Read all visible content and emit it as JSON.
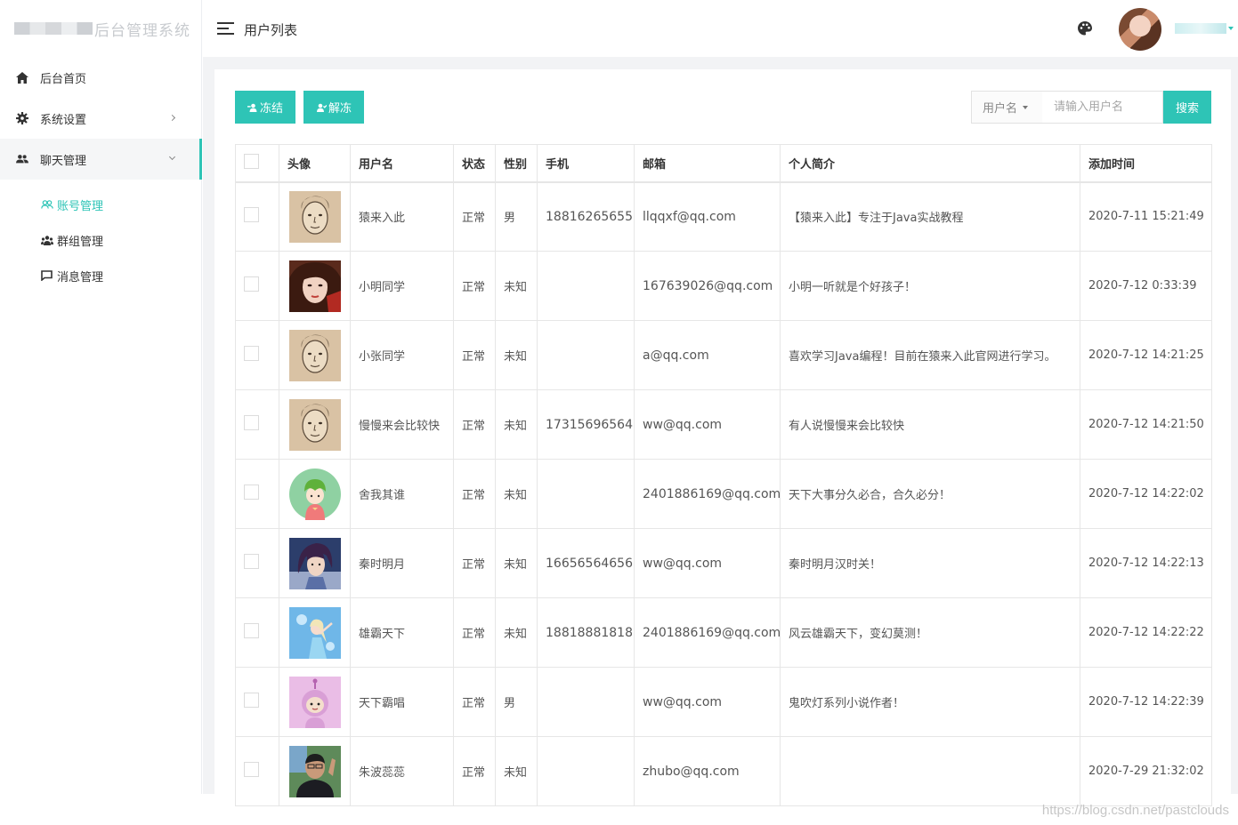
{
  "brand": {
    "title": "后台管理系统"
  },
  "sidebar": {
    "items": [
      {
        "label": "后台首页"
      },
      {
        "label": "系统设置"
      },
      {
        "label": "聊天管理"
      }
    ],
    "sub_items": [
      {
        "label": "账号管理"
      },
      {
        "label": "群组管理"
      },
      {
        "label": "消息管理"
      }
    ]
  },
  "header": {
    "title": "用户列表"
  },
  "toolbar": {
    "freeze_label": "冻结",
    "unfreeze_label": "解冻",
    "search_type": "用户名",
    "search_placeholder": "请输入用户名",
    "search_label": "搜索"
  },
  "table": {
    "headers": [
      "头像",
      "用户名",
      "状态",
      "性别",
      "手机",
      "邮箱",
      "个人简介",
      "添加时间"
    ],
    "rows": [
      {
        "avatar": "sketch-face",
        "username": "猿来入此",
        "status": "正常",
        "sex": "男",
        "phone": "18816265655",
        "email": "llqqxf@qq.com",
        "bio": "【猿来入此】专注于Java实战教程",
        "time": "2020-7-11 15:21:49"
      },
      {
        "avatar": "girl-photo",
        "username": "小明同学",
        "status": "正常",
        "sex": "未知",
        "phone": "",
        "email": "167639026@qq.com",
        "bio": "小明一听就是个好孩子！",
        "time": "2020-7-12 0:33:39"
      },
      {
        "avatar": "sketch-face",
        "username": "小张同学",
        "status": "正常",
        "sex": "未知",
        "phone": "",
        "email": "a@qq.com",
        "bio": "喜欢学习Java编程！目前在猿来入此官网进行学习。",
        "time": "2020-7-12 14:21:25"
      },
      {
        "avatar": "sketch-face",
        "username": "慢慢来会比较快",
        "status": "正常",
        "sex": "未知",
        "phone": "17315696564",
        "email": "ww@qq.com",
        "bio": "有人说慢慢来会比较快",
        "time": "2020-7-12 14:21:50"
      },
      {
        "avatar": "cartoon-green",
        "username": "舍我其谁",
        "status": "正常",
        "sex": "未知",
        "phone": "",
        "email": "2401886169@qq.com",
        "bio": "天下大事分久必合，合久必分！",
        "time": "2020-7-12 14:22:02"
      },
      {
        "avatar": "anime-warrior",
        "username": "秦时明月",
        "status": "正常",
        "sex": "未知",
        "phone": "16656564656",
        "email": "ww@qq.com",
        "bio": "秦时明月汉时关！",
        "time": "2020-7-12 14:22:13"
      },
      {
        "avatar": "ice-princess",
        "username": "雄霸天下",
        "status": "正常",
        "sex": "未知",
        "phone": "18818881818",
        "email": "2401886169@qq.com",
        "bio": "风云雄霸天下，变幻莫测！",
        "time": "2020-7-12 14:22:22"
      },
      {
        "avatar": "pink-cartoon",
        "username": "天下霸唱",
        "status": "正常",
        "sex": "男",
        "phone": "",
        "email": "ww@qq.com",
        "bio": "鬼吹灯系列小说作者！",
        "time": "2020-7-12 14:22:39"
      },
      {
        "avatar": "man-photo",
        "username": "朱波蕊蕊",
        "status": "正常",
        "sex": "未知",
        "phone": "",
        "email": "zhubo@qq.com",
        "bio": "",
        "time": "2020-7-29 21:32:02"
      }
    ]
  },
  "watermark": "https://blog.csdn.net/pastclouds",
  "colors": {
    "accent": "#2ec4b6",
    "unknown": "#f0a04b"
  }
}
